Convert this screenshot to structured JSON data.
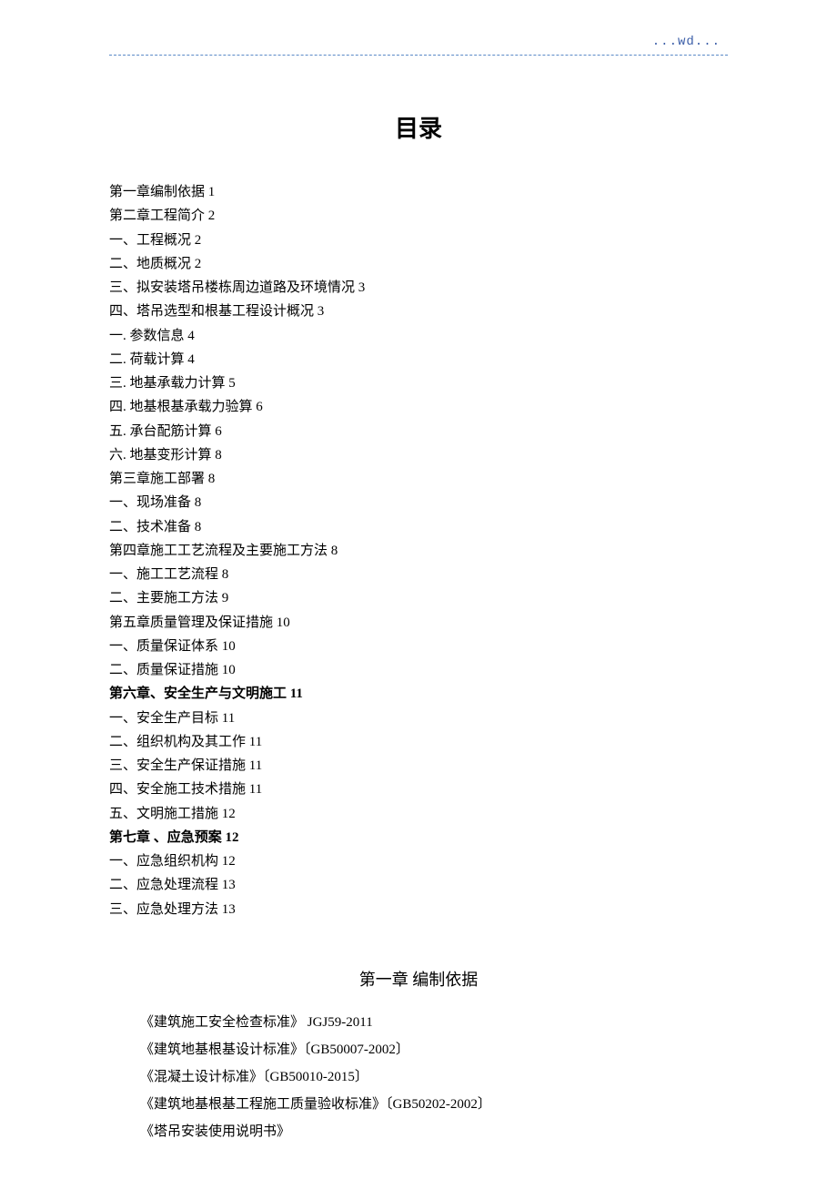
{
  "header": {
    "watermark": "...wd..."
  },
  "title": "目录",
  "toc": [
    {
      "text": "第一章编制依据 1",
      "bold": false
    },
    {
      "text": "第二章工程简介 2",
      "bold": false
    },
    {
      "text": "一、工程概况 2",
      "bold": false
    },
    {
      "text": "二、地质概况 2",
      "bold": false
    },
    {
      "text": "三、拟安装塔吊楼栋周边道路及环境情况 3",
      "bold": false
    },
    {
      "text": "四、塔吊选型和根基工程设计概况 3",
      "bold": false
    },
    {
      "text": "一. 参数信息 4",
      "bold": false
    },
    {
      "text": "二. 荷载计算 4",
      "bold": false
    },
    {
      "text": "三. 地基承载力计算 5",
      "bold": false
    },
    {
      "text": "四. 地基根基承载力验算 6",
      "bold": false
    },
    {
      "text": "五. 承台配筋计算 6",
      "bold": false
    },
    {
      "text": "六. 地基变形计算 8",
      "bold": false
    },
    {
      "text": "第三章施工部署 8",
      "bold": false
    },
    {
      "text": "一、现场准备 8",
      "bold": false
    },
    {
      "text": "二、技术准备 8",
      "bold": false
    },
    {
      "text": "第四章施工工艺流程及主要施工方法 8",
      "bold": false
    },
    {
      "text": "一、施工工艺流程 8",
      "bold": false
    },
    {
      "text": "二、主要施工方法 9",
      "bold": false
    },
    {
      "text": "第五章质量管理及保证措施 10",
      "bold": false
    },
    {
      "text": "一、质量保证体系 10",
      "bold": false
    },
    {
      "text": "二、质量保证措施 10",
      "bold": false
    },
    {
      "text": "第六章、安全生产与文明施工 11",
      "bold": true
    },
    {
      "text": "一、安全生产目标 11",
      "bold": false
    },
    {
      "text": "二、组织机构及其工作 11",
      "bold": false
    },
    {
      "text": "三、安全生产保证措施 11",
      "bold": false
    },
    {
      "text": "四、安全施工技术措施 11",
      "bold": false
    },
    {
      "text": "五、文明施工措施 12",
      "bold": false
    },
    {
      "text": "第七章 、应急预案 12",
      "bold": true
    },
    {
      "text": "一、应急组织机构 12",
      "bold": false
    },
    {
      "text": "二、应急处理流程 13",
      "bold": false
    },
    {
      "text": "三、应急处理方法 13",
      "bold": false
    }
  ],
  "chapter1": {
    "title": "第一章  编制依据",
    "lines": [
      "《建筑施工安全检查标准》   JGJ59-2011",
      "《建筑地基根基设计标准》〔GB50007-2002〕",
      "《混凝土设计标准》〔GB50010-2015〕",
      "《建筑地基根基工程施工质量验收标准》〔GB50202-2002〕",
      "《塔吊安装使用说明书》"
    ]
  }
}
